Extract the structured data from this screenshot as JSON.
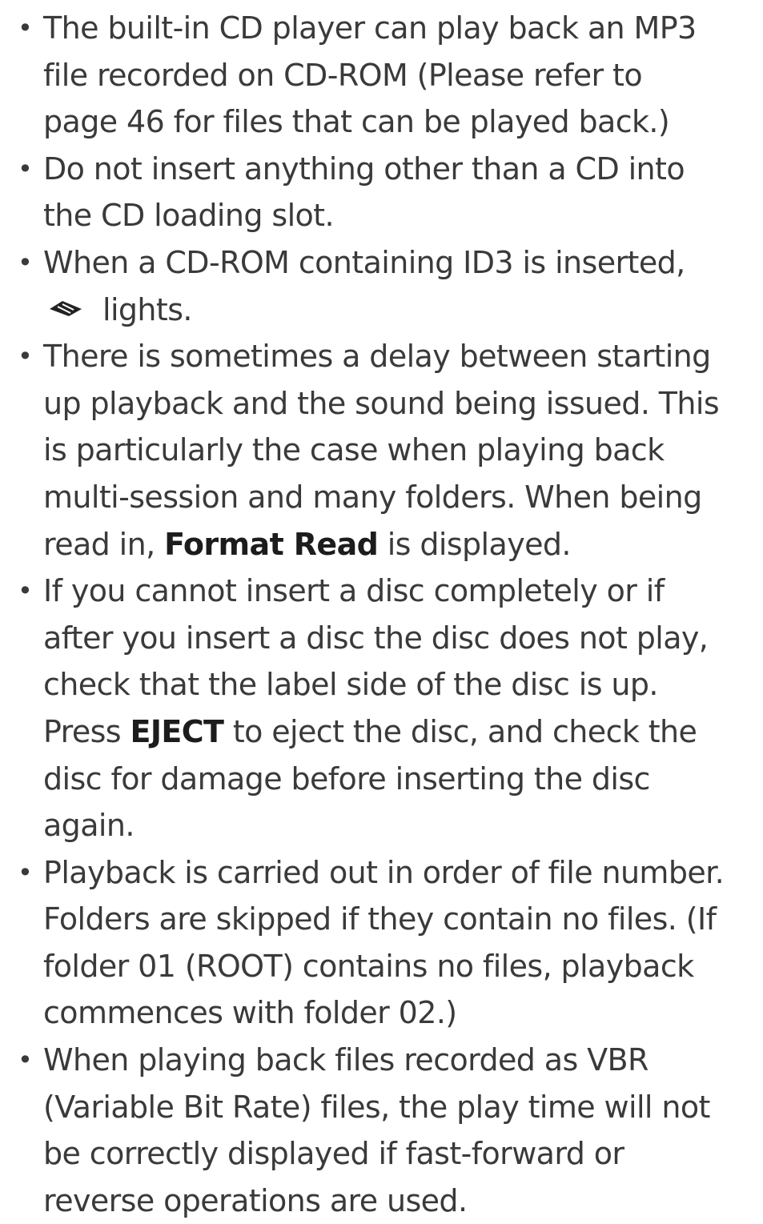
{
  "bullet_symbol": "•",
  "items": [
    {
      "lines": [
        "The built-in CD player can play back an MP3",
        "file recorded on CD-ROM (Please refer to",
        "page 46 for files that can be played back.)"
      ]
    },
    {
      "lines": [
        "Do not insert anything other than a CD into",
        "the CD loading slot."
      ]
    },
    {
      "lines": [
        "When a CD-ROM containing ID3 is inserted,"
      ],
      "icon": "id3-tag-icon",
      "icon_suffix": "lights."
    },
    {
      "lines": [
        "There is sometimes a delay between starting",
        "up playback and the sound being issued. This",
        "is particularly the case when playing back",
        "multi-session and many folders. When being"
      ],
      "last_pre": "read in, ",
      "last_bold": "Format Read",
      "last_post": " is displayed."
    },
    {
      "lines": [
        "If you cannot insert a disc completely or if",
        "after you insert a disc the disc does not play,",
        "check that the label side of the disc is up."
      ],
      "mid_pre": "Press ",
      "mid_bold": "EJECT",
      "mid_post": " to eject the disc, and check the",
      "tail_lines": [
        "disc for damage before inserting the disc",
        "again."
      ]
    },
    {
      "lines": [
        "Playback is carried out in order of file number.",
        "Folders are skipped if they contain no files. (If",
        "folder 01 (ROOT) contains no files, playback",
        "commences with folder 02.)"
      ]
    },
    {
      "lines": [
        "When playing back files recorded as VBR",
        "(Variable Bit Rate) files, the play time will not",
        "be correctly displayed if fast-forward or",
        "reverse operations are used."
      ]
    }
  ]
}
